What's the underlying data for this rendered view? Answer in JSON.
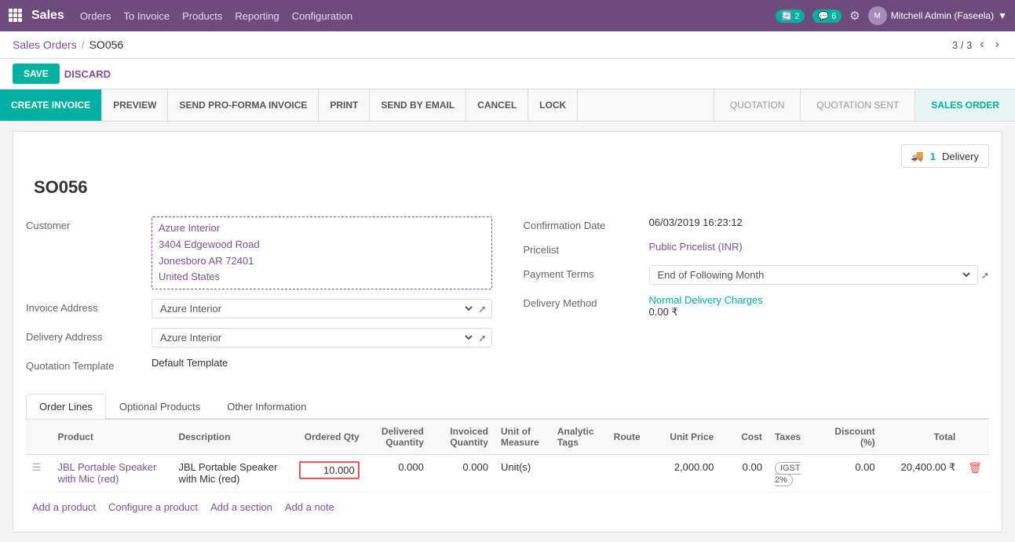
{
  "topnav": {
    "app_name": "Sales",
    "menu_items": [
      "Orders",
      "To Invoice",
      "Products",
      "Reporting",
      "Configuration"
    ],
    "notifications_count": "2",
    "messages_count": "6",
    "user_name": "Mitchell Admin (Faseela)"
  },
  "breadcrumb": {
    "parent": "Sales Orders",
    "separator": "/",
    "current": "SO056"
  },
  "pager": {
    "text": "3 / 3"
  },
  "action_buttons": {
    "save": "SAVE",
    "discard": "DISCARD"
  },
  "workflow_buttons": [
    {
      "label": "CREATE INVOICE",
      "active": true
    },
    {
      "label": "PREVIEW",
      "active": false
    },
    {
      "label": "SEND PRO-FORMA INVOICE",
      "active": false
    },
    {
      "label": "PRINT",
      "active": false
    },
    {
      "label": "SEND BY EMAIL",
      "active": false
    },
    {
      "label": "CANCEL",
      "active": false
    },
    {
      "label": "LOCK",
      "active": false
    }
  ],
  "status_steps": [
    {
      "label": "QUOTATION",
      "active": false
    },
    {
      "label": "QUOTATION SENT",
      "active": false
    },
    {
      "label": "SALES ORDER",
      "active": true
    }
  ],
  "delivery_widget": {
    "count": "1",
    "label": "Delivery",
    "icon": "🚚"
  },
  "form": {
    "order_number": "SO056",
    "customer_label": "Customer",
    "customer_name": "Azure Interior",
    "customer_address_line1": "3404 Edgewood Road",
    "customer_address_line2": "Jonesboro AR 72401",
    "customer_address_line3": "United States",
    "invoice_address_label": "Invoice Address",
    "invoice_address_value": "Azure Interior",
    "delivery_address_label": "Delivery Address",
    "delivery_address_value": "Azure Interior",
    "quotation_template_label": "Quotation Template",
    "quotation_template_value": "Default Template",
    "confirmation_date_label": "Confirmation Date",
    "confirmation_date_value": "06/03/2019 16:23:12",
    "pricelist_label": "Pricelist",
    "pricelist_value": "Public Pricelist (INR)",
    "payment_terms_label": "Payment Terms",
    "payment_terms_value": "End of Following Month",
    "delivery_method_label": "Delivery Method",
    "delivery_method_value": "Normal Delivery Charges",
    "delivery_charges": "0.00 ₹"
  },
  "tabs": [
    {
      "label": "Order Lines",
      "active": true
    },
    {
      "label": "Optional Products",
      "active": false
    },
    {
      "label": "Other Information",
      "active": false
    }
  ],
  "table": {
    "headers": [
      {
        "label": "",
        "class": "col-drag"
      },
      {
        "label": "Product",
        "class": "col-product"
      },
      {
        "label": "Description",
        "class": "col-desc"
      },
      {
        "label": "Ordered Qty",
        "class": "col-ordered right"
      },
      {
        "label": "Delivered Quantity",
        "class": "col-delivered right"
      },
      {
        "label": "Invoiced Quantity",
        "class": "col-invoiced right"
      },
      {
        "label": "Unit of Measure",
        "class": "col-uom"
      },
      {
        "label": "Analytic Tags",
        "class": "col-tags"
      },
      {
        "label": "Route",
        "class": "col-route"
      },
      {
        "label": "Unit Price",
        "class": "col-price right"
      },
      {
        "label": "Cost",
        "class": "col-cost right"
      },
      {
        "label": "Taxes",
        "class": "col-tax"
      },
      {
        "label": "Discount (%)",
        "class": "col-disc right"
      },
      {
        "label": "Total",
        "class": "col-total right"
      },
      {
        "label": "",
        "class": "col-del"
      }
    ],
    "rows": [
      {
        "product": "JBL Portable Speaker with Mic (red)",
        "description": "JBL Portable Speaker with Mic (red)",
        "ordered_qty": "10.000",
        "delivered_qty": "0.000",
        "invoiced_qty": "0.000",
        "uom": "Unit(s)",
        "analytic_tags": "",
        "route": "",
        "unit_price": "2,000.00",
        "cost": "0.00",
        "taxes": "IGST 2%",
        "discount": "0.00",
        "total": "20,400.00 ₹"
      }
    ],
    "add_buttons": [
      {
        "label": "Add a product"
      },
      {
        "label": "Configure a product"
      },
      {
        "label": "Add a section"
      },
      {
        "label": "Add a note"
      }
    ]
  }
}
